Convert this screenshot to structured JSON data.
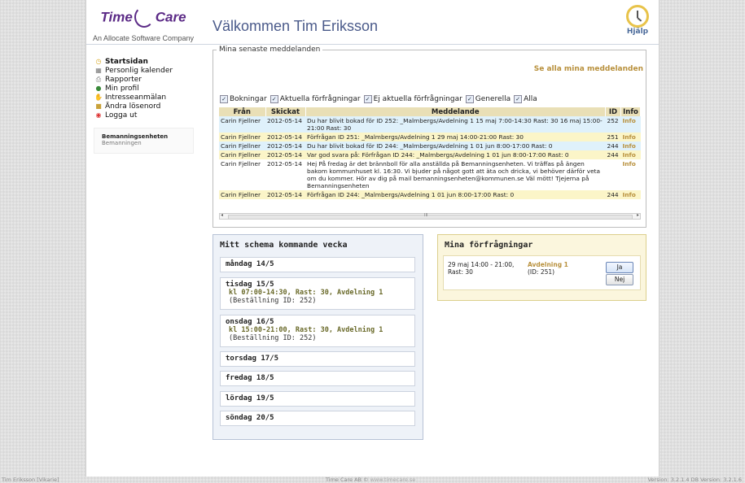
{
  "logo": {
    "brand_left": "Time",
    "brand_right": "Care",
    "tagline": "An Allocate Software Company"
  },
  "header": {
    "welcome": "Välkommen Tim Eriksson",
    "help_label": "Hjälp"
  },
  "nav": {
    "items": [
      {
        "label": "Startsidan",
        "icon": "clock-icon"
      },
      {
        "label": "Personlig kalender",
        "icon": "calendar-icon"
      },
      {
        "label": "Rapporter",
        "icon": "printer-icon"
      },
      {
        "label": "Min profil",
        "icon": "user-icon"
      },
      {
        "label": "Intresseanmälan",
        "icon": "hand-icon"
      },
      {
        "label": "Ändra lösenord",
        "icon": "lock-icon"
      },
      {
        "label": "Logga ut",
        "icon": "logout-icon"
      }
    ]
  },
  "unit": {
    "title": "Bemanningsenheten",
    "subtitle": "Bemanningen"
  },
  "messages": {
    "legend": "Mina senaste meddelanden",
    "see_all": "Se alla mina meddelanden",
    "filters": [
      "Bokningar",
      "Aktuella förfrågningar",
      "Ej aktuella förfrågningar",
      "Generella",
      "Alla"
    ],
    "headers": [
      "Från",
      "Skickat",
      "Meddelande",
      "ID",
      "Info"
    ],
    "rows": [
      {
        "from": "Carin Fjellner",
        "sent": "2012-05-14",
        "msg": "Du har blivit bokad för ID 252: _Malmbergs/Avdelning 1 15 maj 7:00-14:30 Rast: 30 16 maj 15:00-21:00 Rast: 30",
        "id": "252",
        "info": "Info"
      },
      {
        "from": "Carin Fjellner",
        "sent": "2012-05-14",
        "msg": "Förfrågan ID 251: _Malmbergs/Avdelning 1 29 maj 14:00-21:00 Rast: 30",
        "id": "251",
        "info": "Info"
      },
      {
        "from": "Carin Fjellner",
        "sent": "2012-05-14",
        "msg": "Du har blivit bokad för ID 244: _Malmbergs/Avdelning 1 01 jun 8:00-17:00 Rast: 0",
        "id": "244",
        "info": "Info"
      },
      {
        "from": "Carin Fjellner",
        "sent": "2012-05-14",
        "msg": "Var god svara på: Förfrågan ID 244: _Malmbergs/Avdelning 1 01 jun 8:00-17:00 Rast: 0",
        "id": "244",
        "info": "Info"
      },
      {
        "from": "Carin Fjellner",
        "sent": "2012-05-14",
        "msg": "Hej På fredag är det brännboll för alla anställda på Bemanningsenheten. Vi träffas på ängen bakom kommunhuset kl. 16:30. Vi bjuder på något gott att äta och dricka, vi behöver därför veta om du kommer. Hör av dig på mail bemanningsenheten@kommunen.se Väl mött! Tjejerna på Bemanningsenheten",
        "id": "",
        "info": "Info"
      },
      {
        "from": "Carin Fjellner",
        "sent": "2012-05-14",
        "msg": "Förfrågan ID 244: _Malmbergs/Avdelning 1 01 jun 8:00-17:00 Rast: 0",
        "id": "244",
        "info": "Info"
      }
    ],
    "scroll_grip": "III"
  },
  "schedule": {
    "title": "Mitt schema kommande vecka",
    "days": [
      {
        "name": "måndag 14/5",
        "shift": "",
        "order": ""
      },
      {
        "name": "tisdag 15/5",
        "shift": "kl 07:00-14:30, Rast: 30, Avdelning 1",
        "order": "(Beställning ID: 252)"
      },
      {
        "name": "onsdag 16/5",
        "shift": "kl 15:00-21:00, Rast: 30, Avdelning 1",
        "order": "(Beställning ID: 252)"
      },
      {
        "name": "torsdag 17/5",
        "shift": "",
        "order": ""
      },
      {
        "name": "fredag 18/5",
        "shift": "",
        "order": ""
      },
      {
        "name": "lördag 19/5",
        "shift": "",
        "order": ""
      },
      {
        "name": "söndag 20/5",
        "shift": "",
        "order": ""
      }
    ]
  },
  "requests": {
    "title": "Mina förfrågningar",
    "item": {
      "when_line1": "29 maj 14:00 - 21:00,",
      "when_line2": "Rast: 30",
      "dept": "Avdelning 1",
      "ref": "(ID: 251)"
    },
    "yes": "Ja",
    "no": "Nej"
  },
  "footer": {
    "user": "Tim Eriksson [Vikarie]",
    "company": "Time Care AB ©",
    "url": "www.timecare.se",
    "version": "Version: 3.2.1.4   DB Version: 3.2.1.6"
  },
  "colors": {
    "accent_gold": "#b8903c",
    "brand_purple": "#5b2a86",
    "heading_blue": "#4a5a8a"
  }
}
